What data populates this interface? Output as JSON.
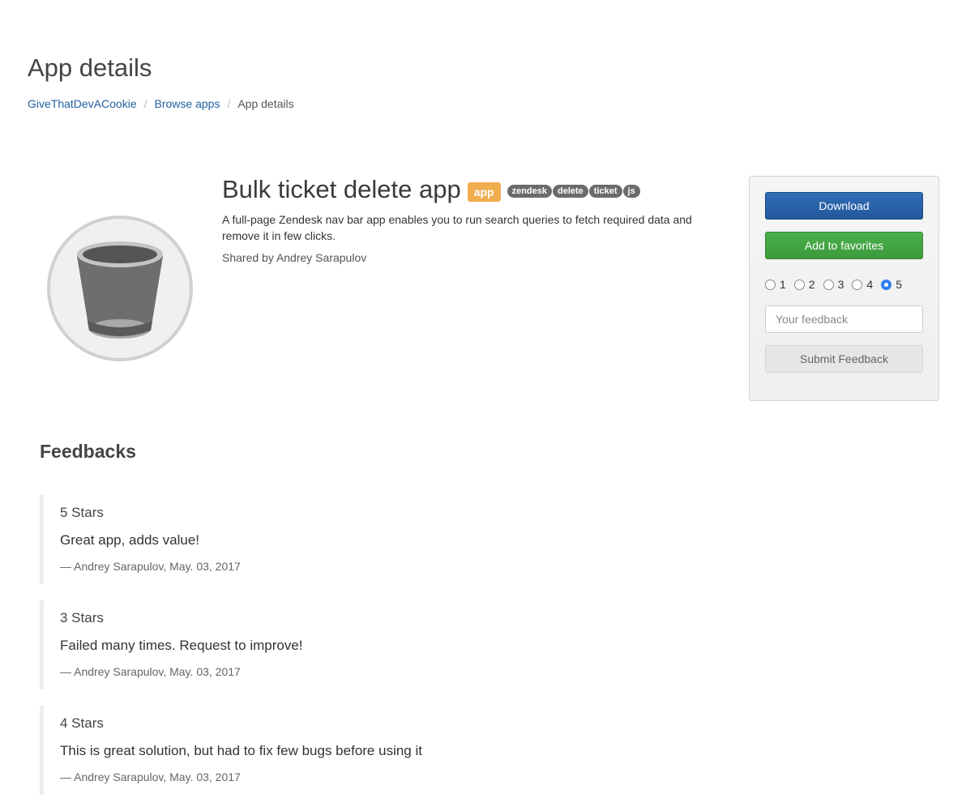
{
  "header": {
    "title": "App details",
    "breadcrumb": [
      {
        "label": "GiveThatDevACookie"
      },
      {
        "label": "Browse apps"
      },
      {
        "label": "App details"
      }
    ]
  },
  "app": {
    "icon": "trash-can-icon",
    "name": "Bulk ticket delete app",
    "type_label": "app",
    "tags": [
      "zendesk",
      "delete",
      "ticket",
      "js"
    ],
    "description": "A full-page Zendesk nav bar app enables you to run search queries to fetch required data and remove it in few clicks.",
    "shared_by": "Shared by Andrey Sarapulov"
  },
  "panel": {
    "download_label": "Download",
    "favorites_label": "Add to favorites",
    "rating_options": [
      "1",
      "2",
      "3",
      "4",
      "5"
    ],
    "selected_rating": "5",
    "feedback_placeholder": "Your feedback",
    "feedback_value": "",
    "submit_label": "Submit Feedback"
  },
  "feedbacks": {
    "title": "Feedbacks",
    "items": [
      {
        "stars": "5 Stars",
        "text": "Great app, adds value!",
        "meta": "— Andrey Sarapulov, May. 03, 2017"
      },
      {
        "stars": "3 Stars",
        "text": "Failed many times. Request to improve!",
        "meta": "— Andrey Sarapulov, May. 03, 2017"
      },
      {
        "stars": "4 Stars",
        "text": "This is great solution, but had to fix few bugs before using it",
        "meta": "— Andrey Sarapulov, May. 03, 2017"
      }
    ]
  },
  "colors": {
    "link": "#23609f",
    "download": "#2a63a9",
    "favorites": "#43a544",
    "type_label": "#f0ad4e",
    "tag": "#6b6b6b",
    "radio_checked": "#2f7ef1"
  }
}
